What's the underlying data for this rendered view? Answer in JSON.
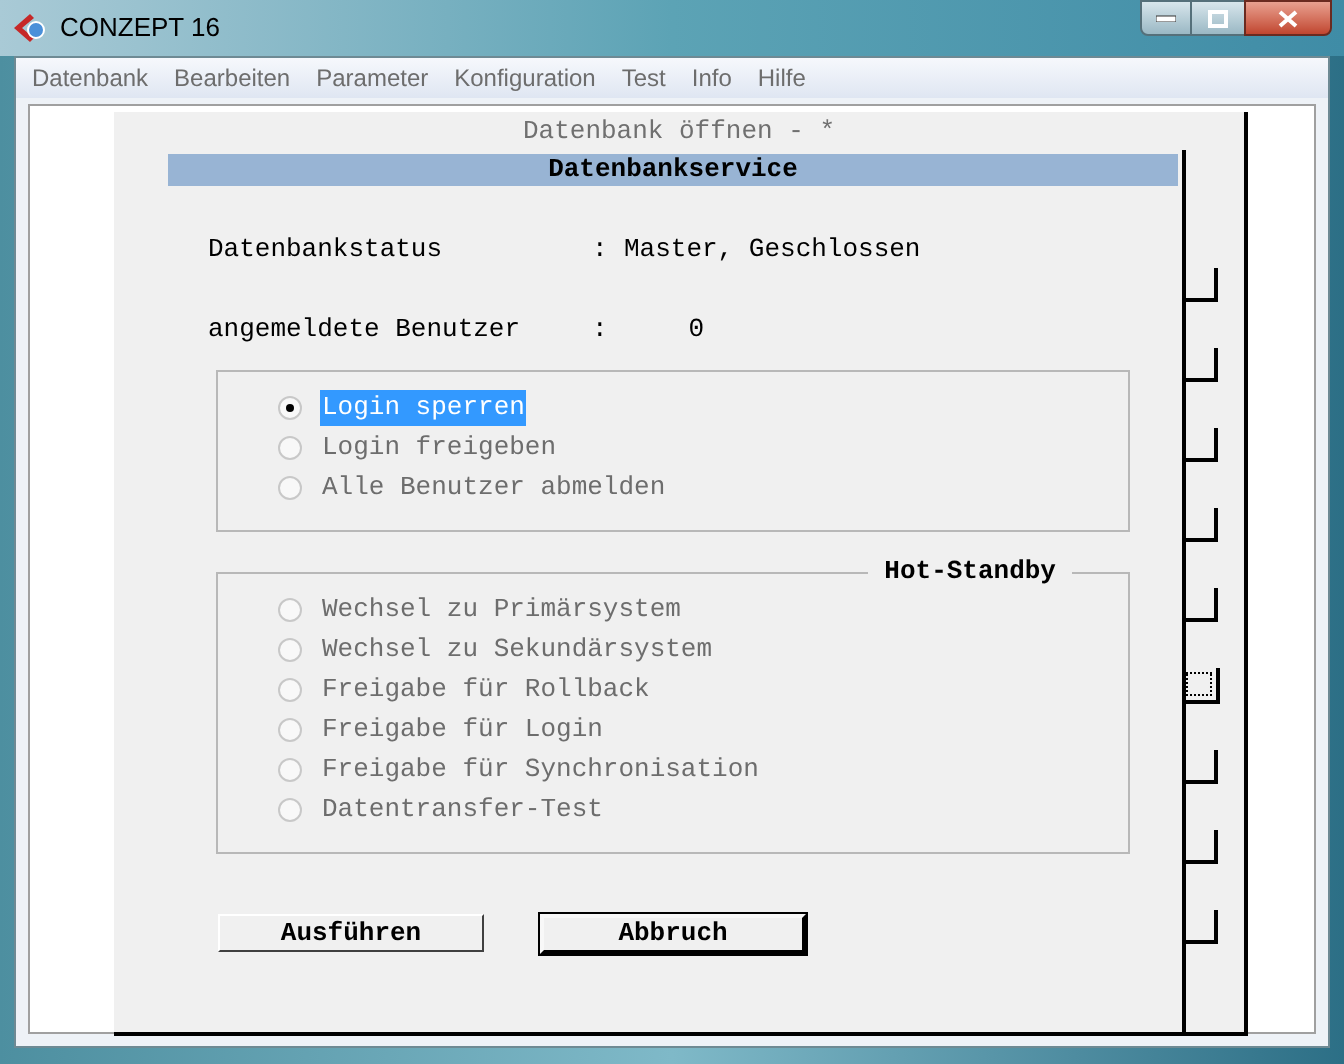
{
  "window": {
    "title": "CONZEPT 16"
  },
  "menu": [
    "Datenbank",
    "Bearbeiten",
    "Parameter",
    "Konfiguration",
    "Test",
    "Info",
    "Hilfe"
  ],
  "outer_dialog": {
    "title": "Datenbank öffnen - *",
    "side_buttons": [
      {
        "focused": false
      },
      {
        "focused": false
      },
      {
        "focused": false
      },
      {
        "focused": false
      },
      {
        "focused": false
      },
      {
        "focused": true
      },
      {
        "focused": false
      },
      {
        "focused": false
      },
      {
        "focused": false
      }
    ]
  },
  "dialog": {
    "title": "Datenbankservice",
    "fields": [
      {
        "label": "Datenbankstatus",
        "separator": ":",
        "kind": "text",
        "value": "Master, Geschlossen"
      },
      {
        "label": "angemeldete Benutzer",
        "separator": ":",
        "kind": "count",
        "value": "0"
      }
    ],
    "login_options": [
      {
        "label": "Login sperren",
        "selected": true
      },
      {
        "label": "Login freigeben",
        "selected": false
      },
      {
        "label": "Alle Benutzer abmelden",
        "selected": false
      }
    ],
    "hot_standby": {
      "title": "Hot-Standby",
      "options": [
        {
          "label": "Wechsel zu Primärsystem",
          "selected": false
        },
        {
          "label": "Wechsel zu Sekundärsystem",
          "selected": false
        },
        {
          "label": "Freigabe für Rollback",
          "selected": false
        },
        {
          "label": "Freigabe für Login",
          "selected": false
        },
        {
          "label": "Freigabe für Synchronisation",
          "selected": false
        },
        {
          "label": "Datentransfer-Test",
          "selected": false
        }
      ]
    },
    "buttons": [
      {
        "label": "Ausführen",
        "default": false
      },
      {
        "label": "Abbruch",
        "default": true
      }
    ]
  }
}
